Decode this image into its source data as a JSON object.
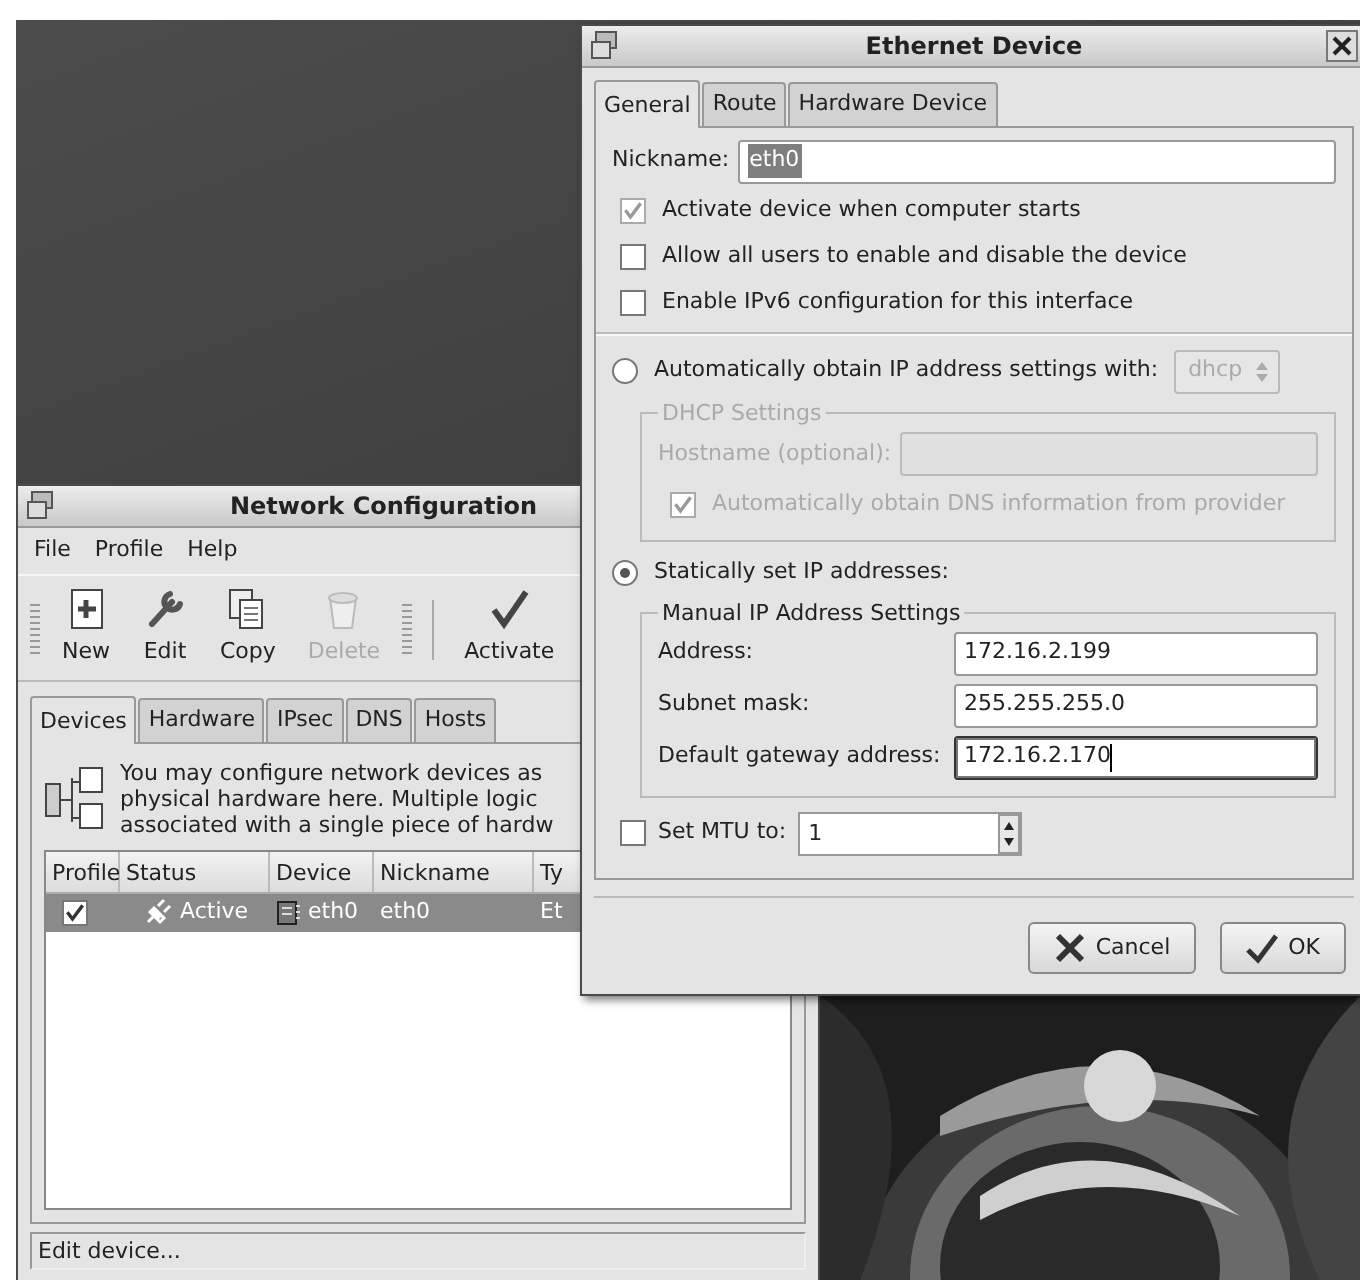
{
  "network_window": {
    "title": "Network Configuration",
    "menu": [
      "File",
      "Profile",
      "Help"
    ],
    "toolbar": [
      {
        "label": "New",
        "kind": "new",
        "disabled": false
      },
      {
        "label": "Edit",
        "kind": "edit",
        "disabled": false
      },
      {
        "label": "Copy",
        "kind": "copy",
        "disabled": false
      },
      {
        "label": "Delete",
        "kind": "delete",
        "disabled": true
      },
      {
        "label": "Activate",
        "kind": "activate",
        "disabled": false
      }
    ],
    "tabs": [
      {
        "label": "Devices",
        "selected": true
      },
      {
        "label": "Hardware",
        "selected": false
      },
      {
        "label": "IPsec",
        "selected": false
      },
      {
        "label": "DNS",
        "selected": false
      },
      {
        "label": "Hosts",
        "selected": false
      }
    ],
    "description_lines": [
      "You may configure network devices as",
      "physical hardware here.  Multiple logic",
      "associated with a single piece of hardw"
    ],
    "table": {
      "columns": [
        "Profile",
        "Status",
        "Device",
        "Nickname",
        "Ty"
      ],
      "rows": [
        {
          "checked": true,
          "status": "Active",
          "device": "eth0",
          "nickname": "eth0",
          "column_5": "Et",
          "selected": true
        }
      ]
    },
    "status_bar": "Edit device..."
  },
  "dialog": {
    "title": "Ethernet Device",
    "tabs": [
      {
        "label": "General",
        "selected": true
      },
      {
        "label": "Route",
        "selected": false
      },
      {
        "label": "Hardware Device",
        "selected": false
      }
    ],
    "nickname": {
      "label": "Nickname:",
      "value": "eth0",
      "selected": true
    },
    "options": [
      {
        "label": "Activate device when computer starts",
        "checked": true
      },
      {
        "label": "Allow all users to enable and disable the device",
        "checked": false
      },
      {
        "label": "Enable IPv6 configuration for this interface",
        "checked": false
      }
    ],
    "auto_ip": {
      "label": "Automatically obtain IP address settings with:",
      "selected": false,
      "protocol": "dhcp"
    },
    "dhcp_settings": {
      "title": "DHCP Settings",
      "disabled": true,
      "hostname_label": "Hostname (optional):",
      "dns_label": "Automatically obtain DNS information from provider",
      "dns_checked": true
    },
    "static_ip": {
      "label": "Statically set IP addresses:",
      "selected": true
    },
    "manual_settings": {
      "title": "Manual IP Address Settings",
      "fields": [
        {
          "label": "Address:",
          "value": "172.16.2.199",
          "focused": false
        },
        {
          "label": "Subnet mask:",
          "value": "255.255.255.0",
          "focused": false
        },
        {
          "label": "Default gateway address:",
          "value": "172.16.2.170",
          "focused": true
        }
      ]
    },
    "mtu": {
      "label": "Set MTU to:",
      "checked": false,
      "value": "1"
    },
    "buttons": [
      {
        "label": "Cancel",
        "kind": "cancel"
      },
      {
        "label": "OK",
        "kind": "ok"
      }
    ]
  }
}
